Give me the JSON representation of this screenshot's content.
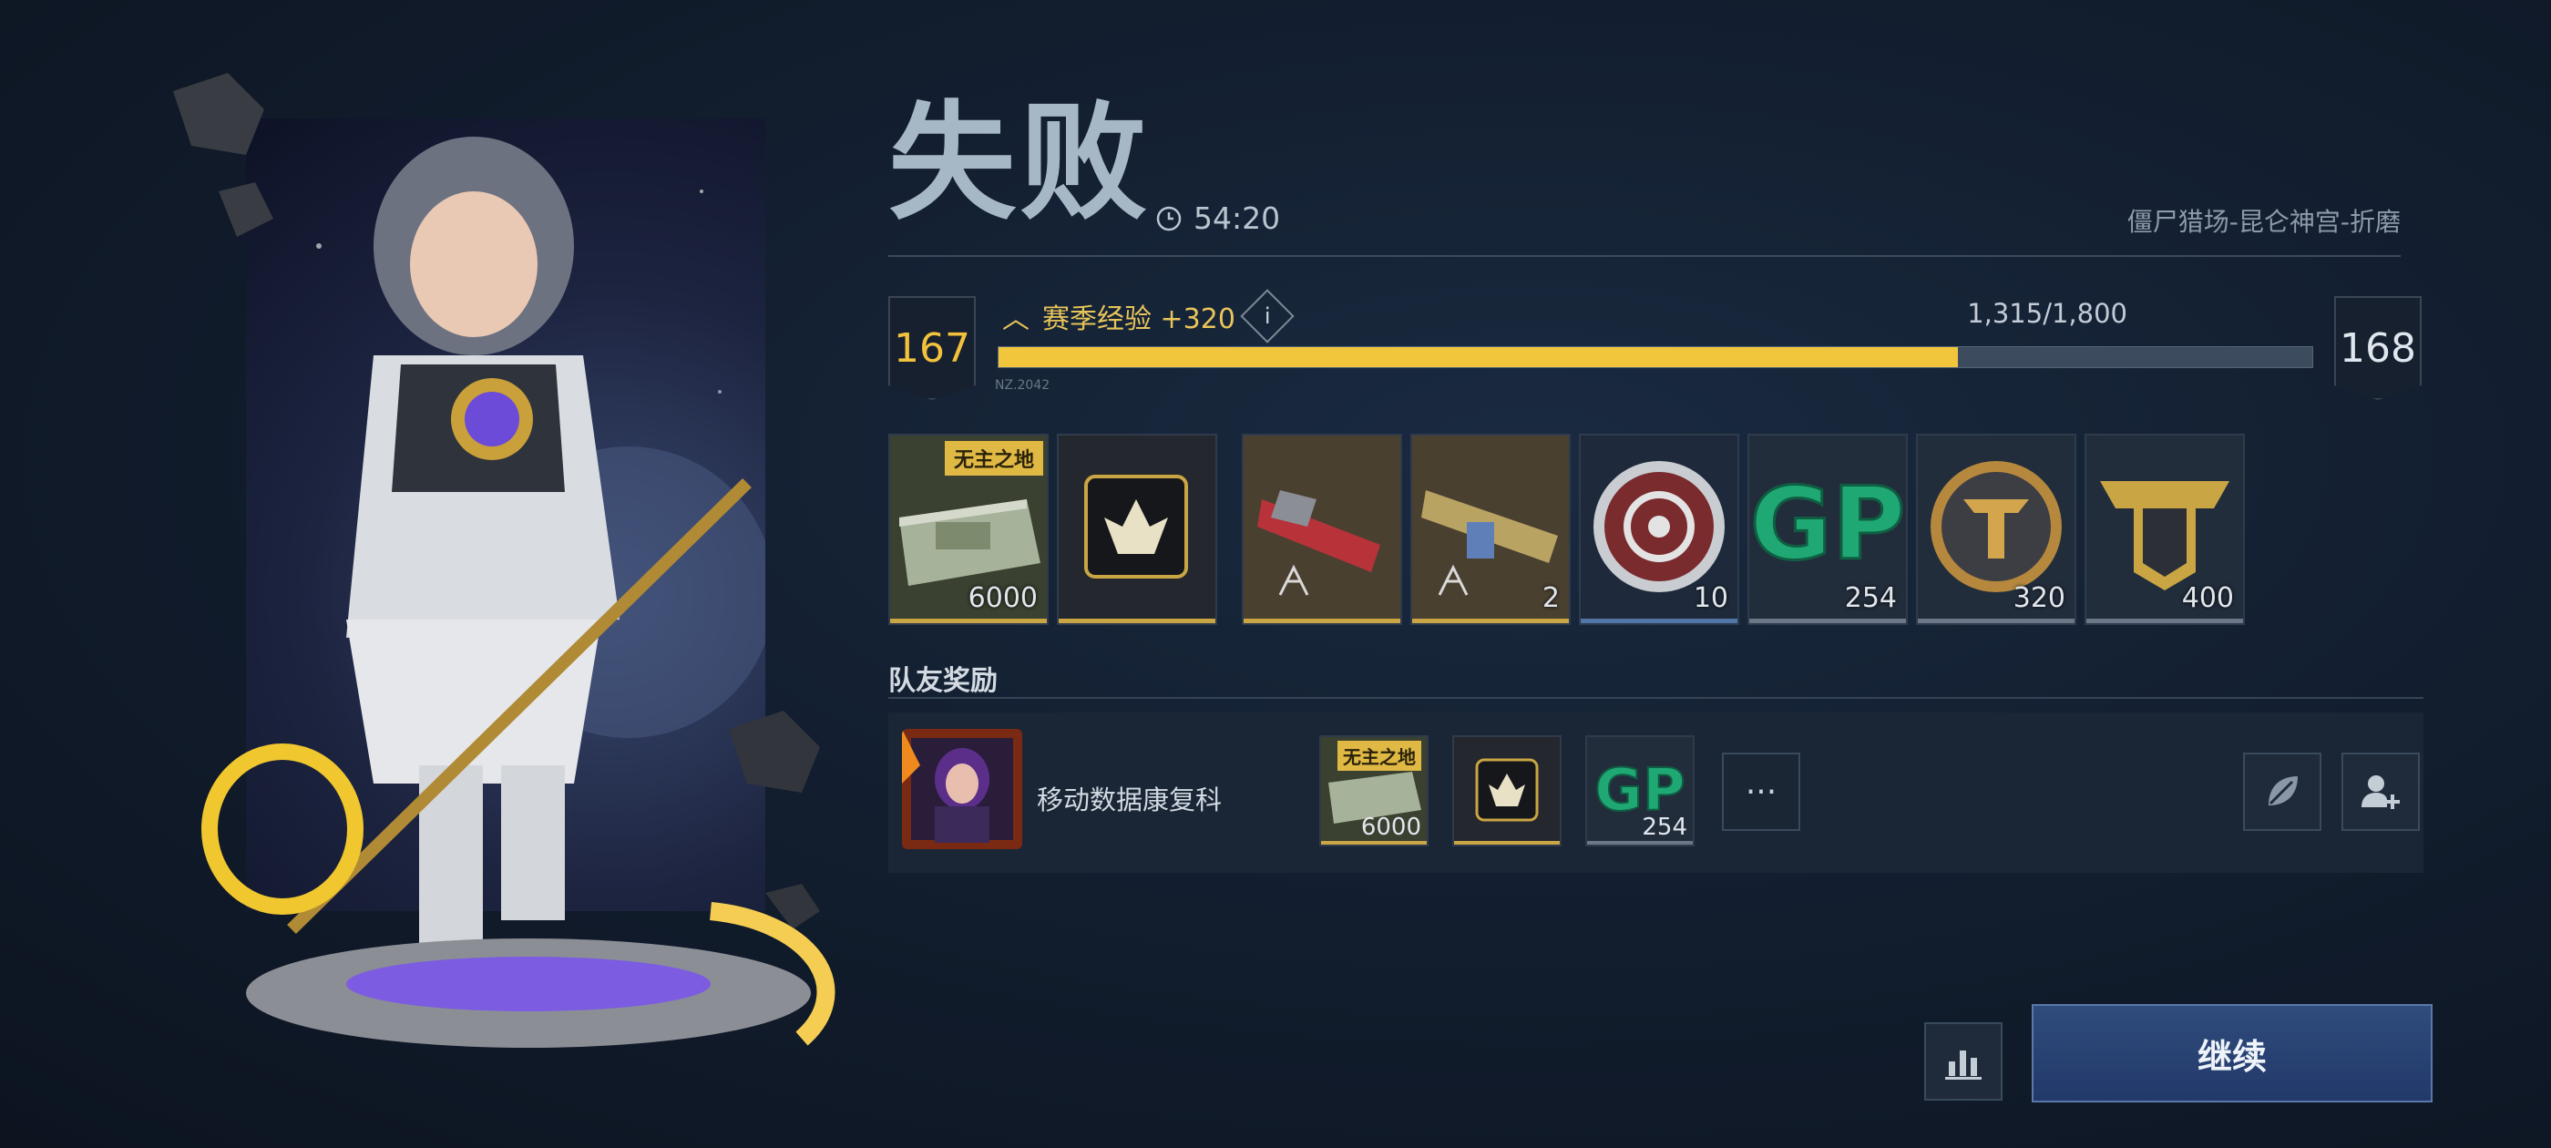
{
  "header": {
    "result_title": "失败",
    "timer": "54:20",
    "mode_name": "僵尸猎场-昆仑神宫-折磨"
  },
  "level": {
    "current": "167",
    "next": "168",
    "exp_label": "赛季经验 +320",
    "exp_progress": "1,315/1,800",
    "exp_fraction": 0.7305,
    "tag": "NZ.2042"
  },
  "rewards": [
    {
      "icon": "cash-stack-icon",
      "count": "6000",
      "badge": "无主之地"
    },
    {
      "icon": "emblem-card-icon",
      "count": ""
    },
    {
      "icon": "weapon-blueprint-red-icon",
      "count": ""
    },
    {
      "icon": "weapon-blueprint-gold-icon",
      "count": "2"
    },
    {
      "icon": "target-coin-icon",
      "count": "10"
    },
    {
      "icon": "gp-icon",
      "count": "254"
    },
    {
      "icon": "gold-emblem-coin-icon",
      "count": "320"
    },
    {
      "icon": "rank-badge-icon",
      "count": "400"
    }
  ],
  "team": {
    "section_title": "队友奖励",
    "player_name": "移动数据康复科",
    "rewards": [
      {
        "icon": "cash-stack-icon",
        "count": "6000",
        "badge": "无主之地"
      },
      {
        "icon": "emblem-card-icon",
        "count": ""
      },
      {
        "icon": "gp-icon",
        "count": "254"
      }
    ],
    "more_label": "···"
  },
  "actions": {
    "continue_label": "继续"
  },
  "colors": {
    "accent_gold": "#f1c63c",
    "button_blue": "#2f4c7c",
    "gp_green": "#1fa874"
  }
}
